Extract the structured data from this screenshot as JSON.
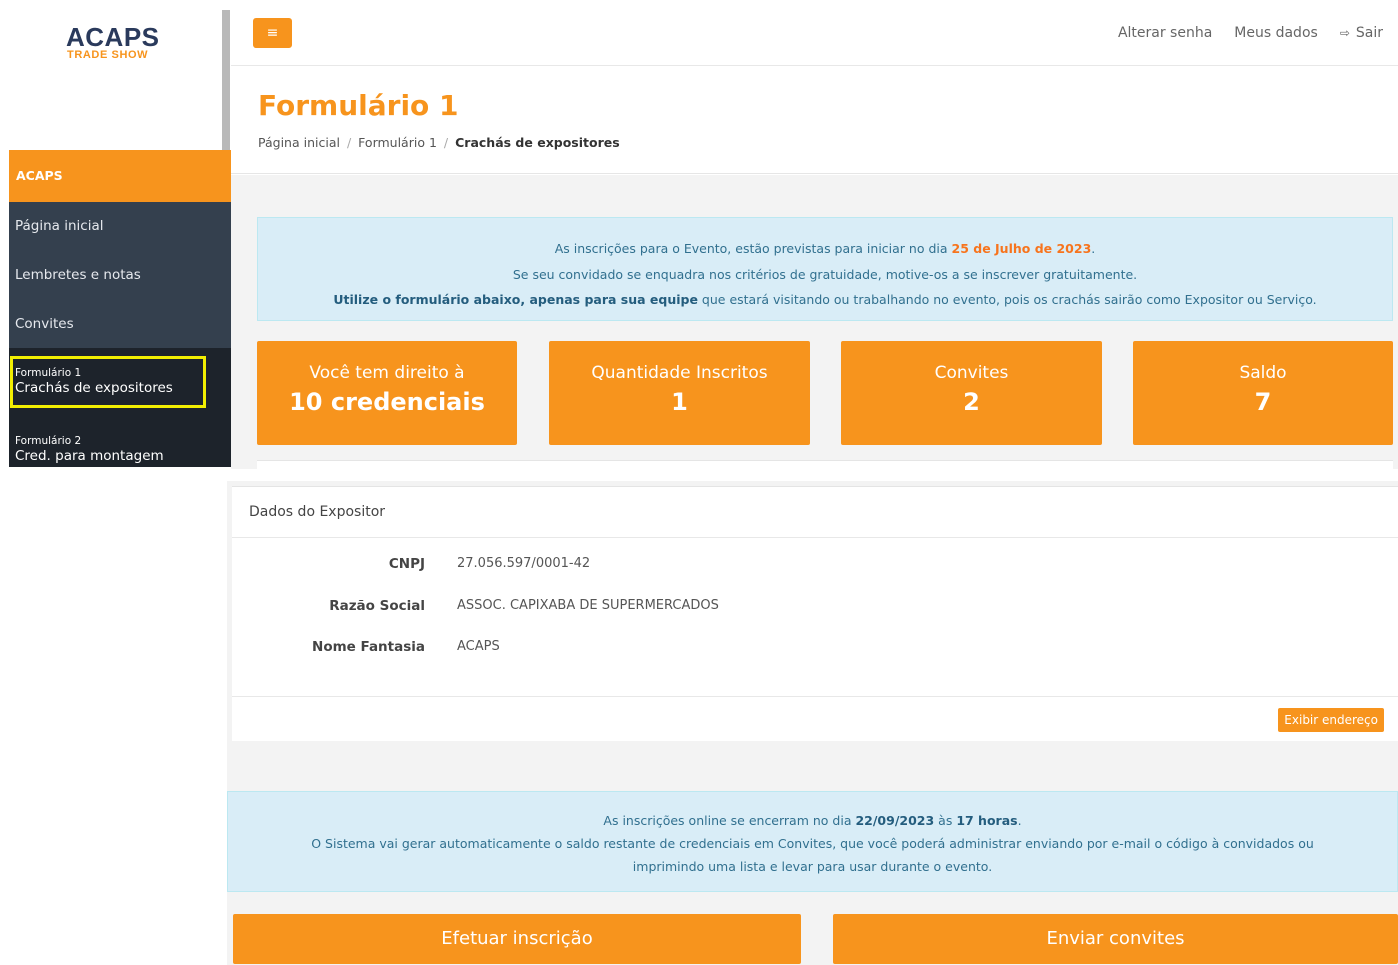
{
  "logo": {
    "line1": "ACAPS",
    "line2": "TRADE SHOW"
  },
  "sidebar": {
    "header": "ACAPS",
    "items": [
      {
        "label": "Página inicial"
      },
      {
        "label": "Lembretes e notas"
      },
      {
        "label": "Convites"
      }
    ],
    "forms": [
      {
        "small": "Formulário 1",
        "big": "Crachás de expositores"
      },
      {
        "small": "Formulário 2",
        "big": "Cred. para montagem"
      }
    ]
  },
  "topbar": {
    "menu_icon": "hamburger-icon",
    "change_password": "Alterar senha",
    "my_data": "Meus dados",
    "logout": "Sair",
    "logout_icon": "sign-out-icon"
  },
  "page": {
    "title": "Formulário 1",
    "breadcrumb": [
      "Página inicial",
      "Formulário 1",
      "Crachás de expositores"
    ]
  },
  "notice1": {
    "line1_prefix": "As inscrições para o Evento, estão previstas para iniciar no dia ",
    "line1_date": "25 de Julho de 2023",
    "line1_suffix": ".",
    "line2": "Se seu convidado se enquadra nos critérios de gratuidade, motive-os a se inscrever gratuitamente.",
    "line3_bold": "Utilize o formulário abaixo, apenas para sua equipe",
    "line3_rest": " que estará visitando ou trabalhando no evento, pois os crachás sairão como Expositor ou Serviço."
  },
  "stats": [
    {
      "label": "Você tem direito à",
      "value": "10 credenciais"
    },
    {
      "label": "Quantidade Inscritos",
      "value": "1"
    },
    {
      "label": "Convites",
      "value": "2"
    },
    {
      "label": "Saldo",
      "value": "7"
    }
  ],
  "exhibitor": {
    "heading": "Dados do Expositor",
    "fields": [
      {
        "key": "CNPJ",
        "value": "27.056.597/0001-42"
      },
      {
        "key": "Razão Social",
        "value": "ASSOC. CAPIXABA DE SUPERMERCADOS"
      },
      {
        "key": "Nome Fantasia",
        "value": "ACAPS"
      }
    ],
    "show_address": "Exibir endereço"
  },
  "notice2": {
    "line1_prefix": "As inscrições online se encerram no dia ",
    "line1_date": "22/09/2023",
    "line1_mid": " às ",
    "line1_time": "17 horas",
    "line1_suffix": ".",
    "line2": "O Sistema vai gerar automaticamente o saldo restante de credenciais em Convites, que você poderá administrar enviando por e-mail o código à convidados ou",
    "line3": "imprimindo uma lista e levar para usar durante o evento."
  },
  "actions": {
    "register": "Efetuar inscrição",
    "send_invites": "Enviar convites"
  },
  "colors": {
    "accent": "#f7941d",
    "sidebar_dark": "#1d232b",
    "sidebar_mid": "#34404e",
    "info_bg": "#d9edf7",
    "highlight": "#f2ee02"
  }
}
